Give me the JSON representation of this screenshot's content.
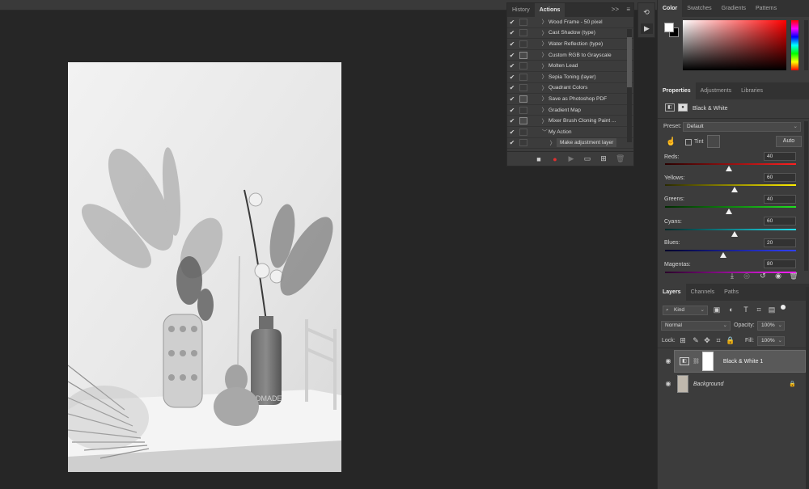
{
  "actions_panel": {
    "tabs": [
      "History",
      "Actions"
    ],
    "active_tab": "Actions",
    "expand_glyph": ">>",
    "menu_glyph": "≡",
    "items": [
      {
        "label": "Wood Frame - 50 pixel",
        "checked": true,
        "dialog": false,
        "expanded": false,
        "indent": 0
      },
      {
        "label": "Cast Shadow (type)",
        "checked": true,
        "dialog": false,
        "expanded": false,
        "indent": 0
      },
      {
        "label": "Water Reflection (type)",
        "checked": true,
        "dialog": false,
        "expanded": false,
        "indent": 0
      },
      {
        "label": "Custom RGB to Grayscale",
        "checked": true,
        "dialog": true,
        "expanded": false,
        "indent": 0
      },
      {
        "label": "Molten Lead",
        "checked": true,
        "dialog": false,
        "expanded": false,
        "indent": 0
      },
      {
        "label": "Sepia Toning (layer)",
        "checked": true,
        "dialog": false,
        "expanded": false,
        "indent": 0
      },
      {
        "label": "Quadrant Colors",
        "checked": true,
        "dialog": false,
        "expanded": false,
        "indent": 0
      },
      {
        "label": "Save as Photoshop PDF",
        "checked": true,
        "dialog": true,
        "expanded": false,
        "indent": 0
      },
      {
        "label": "Gradient Map",
        "checked": true,
        "dialog": false,
        "expanded": false,
        "indent": 0
      },
      {
        "label": "Mixer Brush Cloning Paint ...",
        "checked": true,
        "dialog": true,
        "expanded": false,
        "indent": 0
      },
      {
        "label": "My Action",
        "checked": true,
        "dialog": false,
        "expanded": true,
        "indent": 0
      },
      {
        "label": "Make adjustment layer",
        "checked": true,
        "dialog": false,
        "expanded": false,
        "indent": 1
      }
    ],
    "bottom_buttons": [
      "stop-icon",
      "record-icon",
      "play-icon",
      "folder-icon",
      "new-action-icon",
      "trash-icon"
    ]
  },
  "color_panel": {
    "tabs": [
      "Color",
      "Swatches",
      "Gradients",
      "Patterns"
    ],
    "active_tab": "Color",
    "foreground": "#ffffff",
    "background": "#000000"
  },
  "properties_panel": {
    "tabs": [
      "Properties",
      "Adjustments",
      "Libraries"
    ],
    "active_tab": "Properties",
    "adjustment_title": "Black & White",
    "preset_label": "Preset:",
    "preset_value": "Default",
    "tint_label": "Tint",
    "auto_label": "Auto",
    "sliders": [
      {
        "label": "Reds:",
        "value": "40",
        "gradient": [
          "#2a0000",
          "#ff2020"
        ]
      },
      {
        "label": "Yellows:",
        "value": "60",
        "gradient": [
          "#2a2a00",
          "#ffee00"
        ]
      },
      {
        "label": "Greens:",
        "value": "40",
        "gradient": [
          "#002a00",
          "#20e020"
        ]
      },
      {
        "label": "Cyans:",
        "value": "60",
        "gradient": [
          "#002a2a",
          "#20e0f0"
        ]
      },
      {
        "label": "Blues:",
        "value": "20",
        "gradient": [
          "#00002a",
          "#3040ff"
        ]
      },
      {
        "label": "Magentas:",
        "value": "80",
        "gradient": [
          "#2a002a",
          "#ff20ff"
        ]
      }
    ]
  },
  "layers_panel": {
    "tabs": [
      "Layers",
      "Channels",
      "Paths"
    ],
    "active_tab": "Layers",
    "kind_label": "Kind",
    "blend_mode": "Normal",
    "opacity_label": "Opacity:",
    "opacity_value": "100%",
    "lock_label": "Lock:",
    "fill_label": "Fill:",
    "fill_value": "100%",
    "layers": [
      {
        "name": "Black & White 1",
        "selected": true
      },
      {
        "name": "Background",
        "selected": false
      }
    ]
  }
}
